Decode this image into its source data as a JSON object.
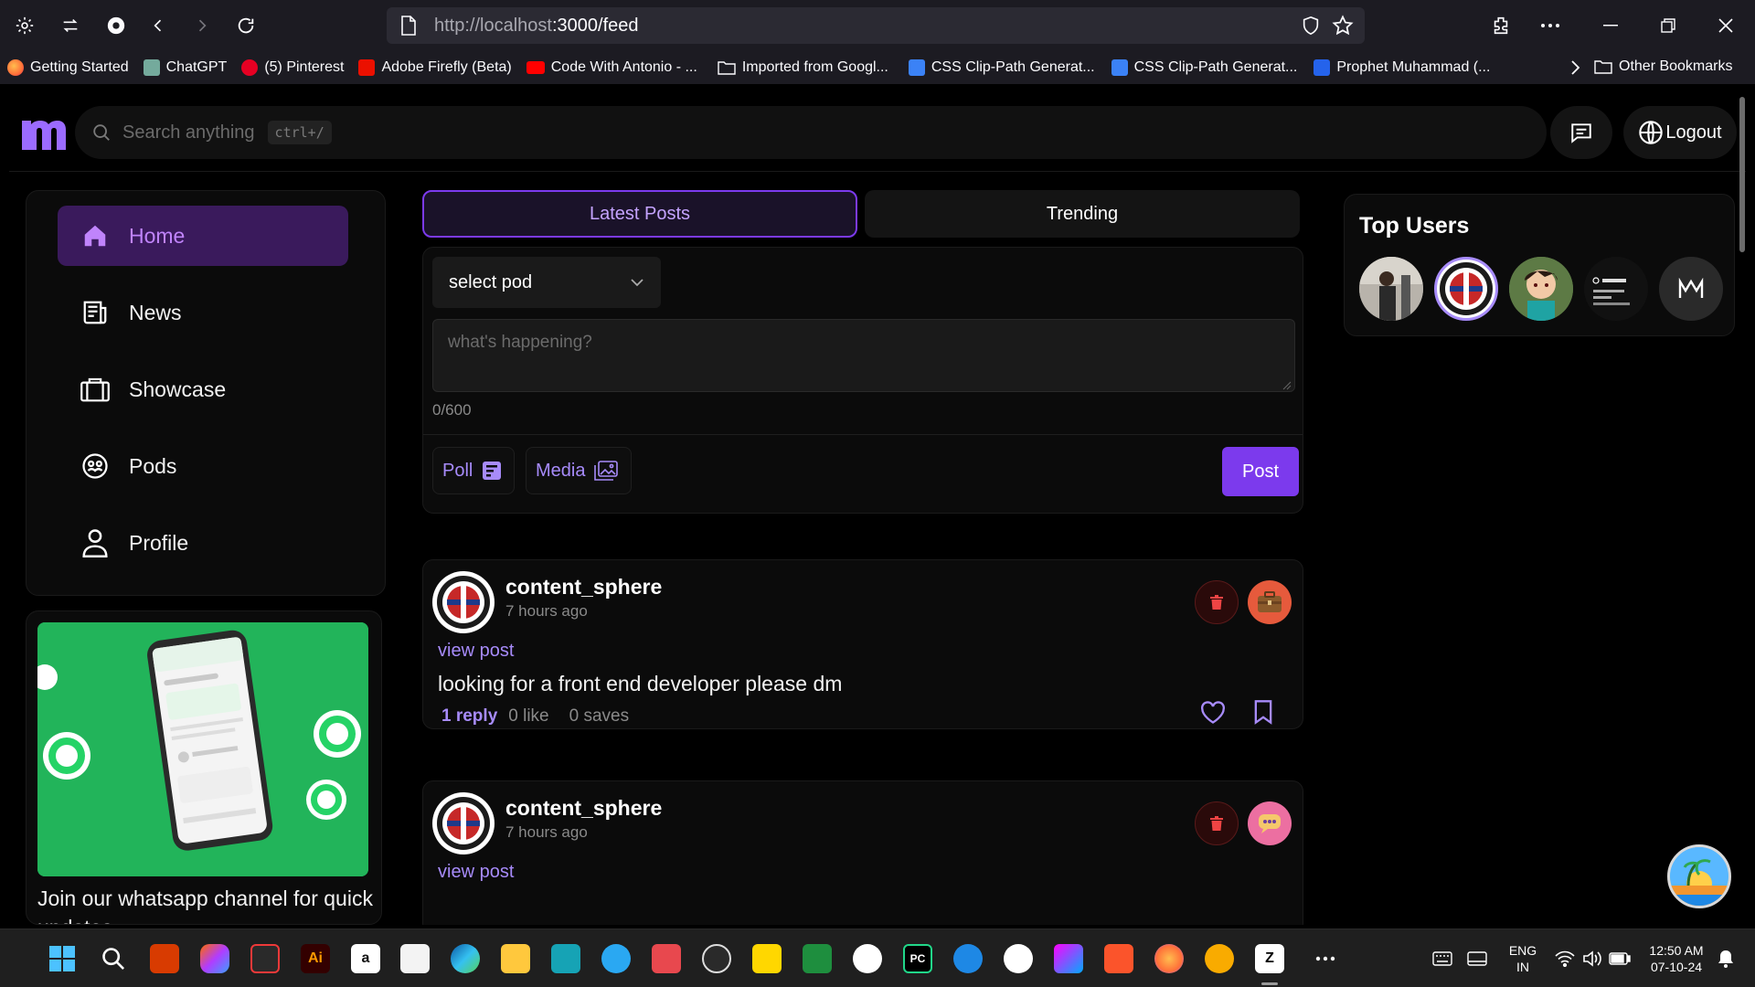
{
  "browser": {
    "url_host": "http://localhost",
    "url_path": ":3000/feed",
    "bookmarks": [
      {
        "label": "Getting Started",
        "color": "#ff7139"
      },
      {
        "label": "ChatGPT",
        "color": "#74aa9c"
      },
      {
        "label": "(5) Pinterest",
        "color": "#e60023"
      },
      {
        "label": "Adobe Firefly (Beta)",
        "color": "#eb1000"
      },
      {
        "label": "Code With Antonio - ...",
        "color": "#ff0000"
      },
      {
        "label": "Imported from Googl...",
        "color": "folder"
      },
      {
        "label": "CSS Clip-Path Generat...",
        "color": "#3b82f6"
      },
      {
        "label": "CSS Clip-Path Generat...",
        "color": "#3b82f6"
      },
      {
        "label": "Prophet Muhammad (...",
        "color": "#2563eb"
      }
    ],
    "other_bookmarks": "Other Bookmarks"
  },
  "topbar": {
    "search_placeholder": "Search anything",
    "search_shortcut": "ctrl+/",
    "logout_label": "Logout"
  },
  "sidebar": {
    "items": [
      {
        "label": "Home",
        "icon": "home-icon",
        "active": true
      },
      {
        "label": "News",
        "icon": "news-icon",
        "active": false
      },
      {
        "label": "Showcase",
        "icon": "briefcase-icon",
        "active": false
      },
      {
        "label": "Pods",
        "icon": "pods-icon",
        "active": false
      },
      {
        "label": "Profile",
        "icon": "user-icon",
        "active": false
      }
    ],
    "promo_text": "Join our whatsapp channel for quick updates"
  },
  "feed": {
    "tabs": [
      {
        "label": "Latest Posts",
        "active": true
      },
      {
        "label": "Trending",
        "active": false
      }
    ],
    "composer": {
      "select_pod": "select pod",
      "textarea_placeholder": "what's happening?",
      "counter": "0/600",
      "poll_label": "Poll",
      "media_label": "Media",
      "post_label": "Post"
    },
    "posts": [
      {
        "username": "content_sphere",
        "time": "7 hours ago",
        "view_post": "view post",
        "body": "looking for a front end developer please dm",
        "replies": "1 reply",
        "likes": "0 like",
        "saves": "0 saves"
      },
      {
        "username": "content_sphere",
        "time": "7 hours ago",
        "view_post": "view post"
      }
    ]
  },
  "right": {
    "top_users_title": "Top Users"
  },
  "taskbar": {
    "lang_line1": "ENG",
    "lang_line2": "IN",
    "time": "12:50 AM",
    "date": "07-10-24"
  },
  "colors": {
    "accent": "#7c3aed",
    "accent_text": "#a78bfa",
    "active_bg": "#3a1a5c"
  }
}
